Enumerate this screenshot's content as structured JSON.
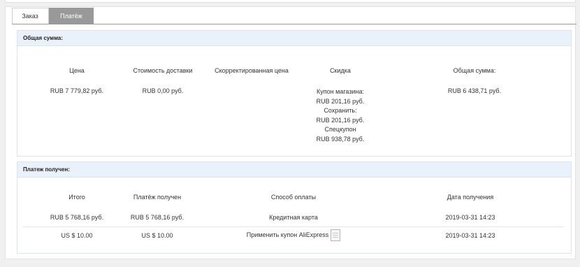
{
  "tabs": [
    {
      "label": "Заказ",
      "active": false
    },
    {
      "label": "Платёж",
      "active": true
    }
  ],
  "summary": {
    "title": "Общая сумма:",
    "headers": {
      "price": "Цена",
      "shipping": "Стоимость доставки",
      "adjusted": "Скорректированная цена",
      "discount": "Скидка",
      "total": "Общая сумма:"
    },
    "values": {
      "price": "RUB 7 779,82 руб.",
      "shipping": "RUB 0,00 руб.",
      "adjusted": "",
      "discount_lines": [
        "Купон магазина:",
        "RUB 201,16 руб.",
        "Сохранить:",
        "RUB 201,16 руб.",
        "Спецкупон",
        "RUB 938,78 руб."
      ],
      "total": "RUB 6 438,71 руб."
    }
  },
  "payment": {
    "title": "Платеж получен:",
    "headers": {
      "total": "Итого",
      "received": "Платёж получен",
      "method": "Способ оплаты",
      "date": "Дата получения"
    },
    "rows": [
      {
        "total": "RUB 5 768,16 руб.",
        "received": "RUB 5 768,16 руб.",
        "method": "Кредитная карта",
        "date": "2019-03-31 14:23",
        "icon": ""
      },
      {
        "total": "US $ 10.00",
        "received": "US $ 10.00",
        "method": "Применить купон AliExpress",
        "date": "2019-03-31 14:23",
        "icon": "document-icon"
      }
    ]
  }
}
